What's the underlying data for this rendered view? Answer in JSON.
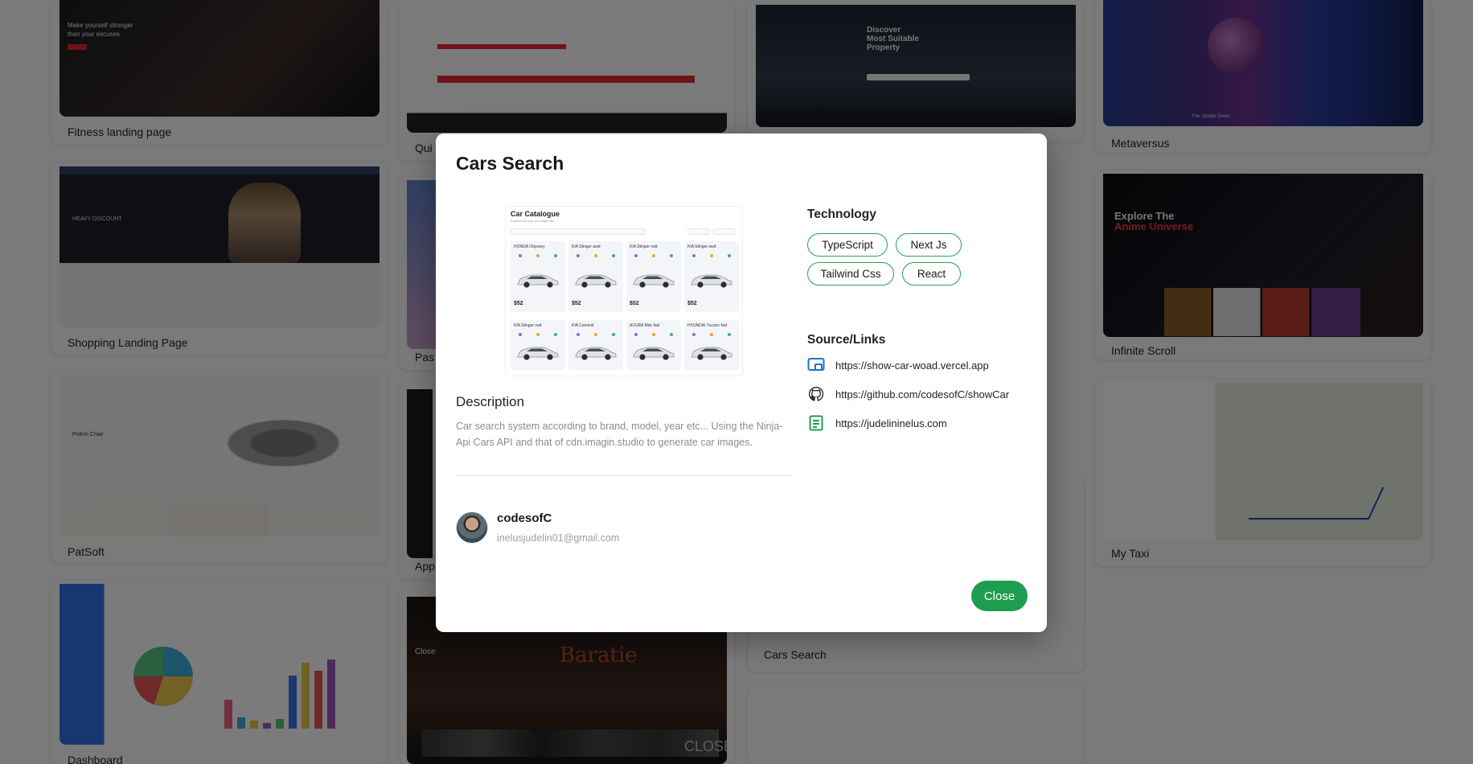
{
  "background_cards": [
    {
      "label": "Fitness landing page",
      "hero_line1": "Make yourself stronger",
      "hero_line2": "than your excuses"
    },
    {
      "label": "Shopping Landing Page",
      "hero": "HEAVY DISCOUNT"
    },
    {
      "label": "PatSoft",
      "hero": "Poltrin Chair"
    },
    {
      "label": "Dashboard"
    },
    {
      "label": "Qui"
    },
    {
      "label": "Pas"
    },
    {
      "label": "App"
    },
    {
      "label": "",
      "hero": "Close",
      "logo": "Baratie",
      "footer": "CLOSE"
    },
    {
      "label": "",
      "hero_line1": "Discover",
      "hero_line2": "Most Suitable",
      "hero_line3": "Property"
    },
    {
      "label": "Cars Search"
    },
    {
      "label": "Metaversus",
      "caption": "The Upside Down"
    },
    {
      "label": "Infinite Scroll",
      "hero_line1": "Explore The",
      "hero_line2": "Anime Universe"
    },
    {
      "label": "My Taxi"
    }
  ],
  "modal": {
    "title": "Cars Search",
    "preview": {
      "title": "Car Catalogue",
      "subtitle": "Explore the cars you might like",
      "cars": [
        {
          "name": "HONDA Odyssey",
          "price": "$52"
        },
        {
          "name": "KIA Stinger awd",
          "price": "$52"
        },
        {
          "name": "KIA Stinger rwd",
          "price": "$52"
        },
        {
          "name": "KIA Stinger awd",
          "price": "$52"
        },
        {
          "name": "KIA Stinger rwd",
          "price": ""
        },
        {
          "name": "KIA Carnival",
          "price": ""
        },
        {
          "name": "ACURA Mdx fwd",
          "price": ""
        },
        {
          "name": "HYUNDAI Tucson fwd",
          "price": ""
        }
      ]
    },
    "description_title": "Description",
    "description": "Car search system according to brand, model, year etc... Using the Ninja-Api Cars API and that of cdn.imagin.studio to generate car images.",
    "author": {
      "name": "codesofC",
      "email": "inelusjudelin01@gmail.com"
    },
    "technology_title": "Technology",
    "technologies": [
      "TypeScript",
      "Next Js",
      "Tailwind Css",
      "React"
    ],
    "sources_title": "Source/Links",
    "links": [
      {
        "icon": "screen-link-icon",
        "url": "https://show-car-woad.vercel.app"
      },
      {
        "icon": "github-icon",
        "url": "https://github.com/codesofC/showCar"
      },
      {
        "icon": "document-icon",
        "url": "https://judelininelus.com"
      }
    ],
    "close_label": "Close"
  },
  "colors": {
    "accent_green": "#1f9d4f",
    "chip_border": "#25a35a",
    "link_icon_blue": "#1e74c7",
    "overlay": "rgba(0,0,0,0.5)"
  }
}
